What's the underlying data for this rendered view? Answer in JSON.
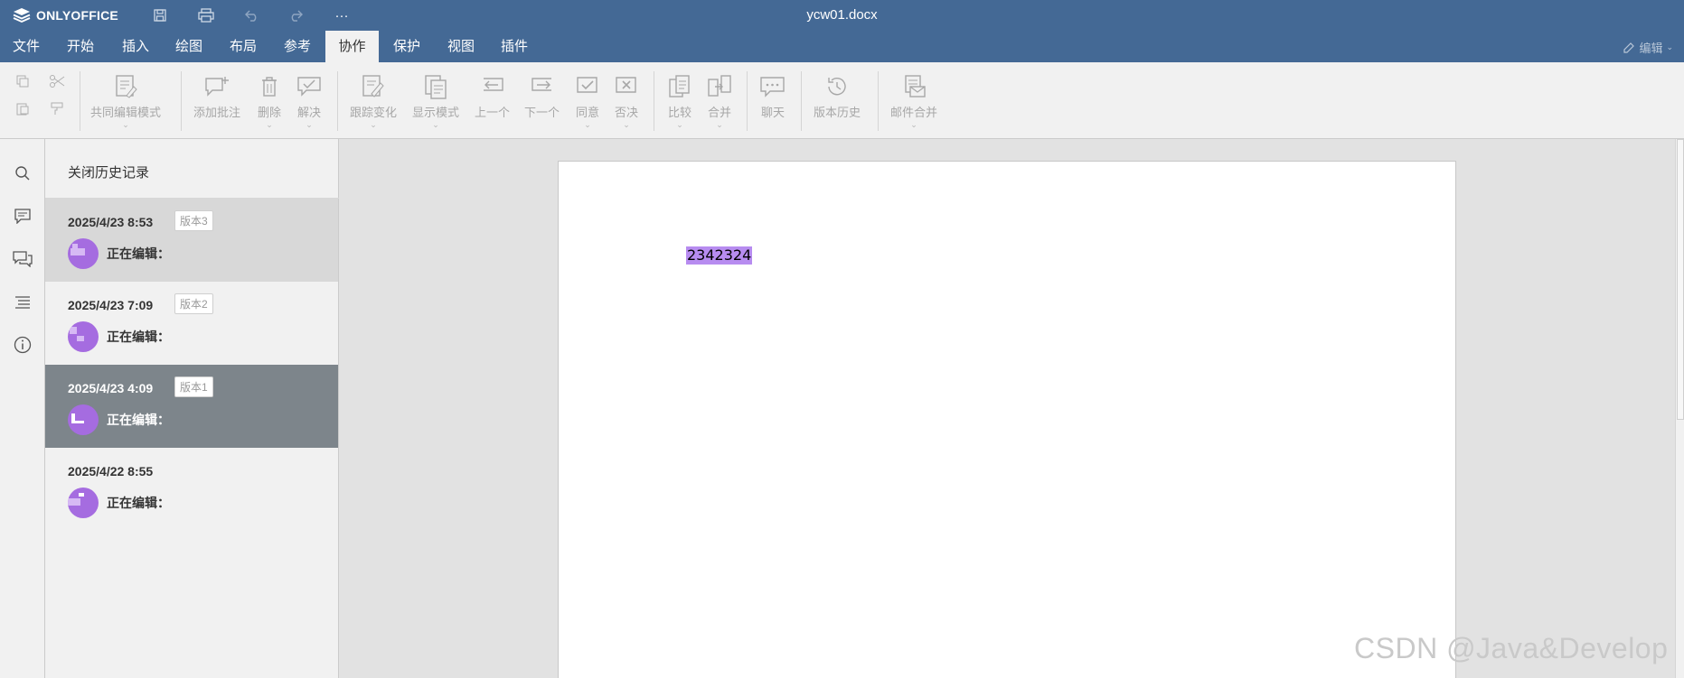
{
  "titlebar": {
    "app_name": "ONLYOFFICE",
    "document_title": "ycw01.docx",
    "more": "···"
  },
  "menu": {
    "tabs": [
      "文件",
      "开始",
      "插入",
      "绘图",
      "布局",
      "参考",
      "协作",
      "保护",
      "视图",
      "插件"
    ],
    "active_tab": "协作",
    "edit_mode_label": "编辑"
  },
  "toolbar": {
    "coedit_mode": "共同编辑模式",
    "add_comment": "添加批注",
    "delete": "删除",
    "resolve": "解决",
    "track_changes": "跟踪变化",
    "display_mode": "显示模式",
    "previous": "上一个",
    "next": "下一个",
    "accept": "同意",
    "reject": "否决",
    "compare": "比较",
    "merge": "合并",
    "chat": "聊天",
    "version_history": "版本历史",
    "mail_merge": "邮件合并"
  },
  "history": {
    "close_label": "关闭历史记录",
    "items": [
      {
        "date": "2025/4/23 8:53",
        "version": "版本3",
        "status": "正在编辑："
      },
      {
        "date": "2025/4/23 7:09",
        "version": "版本2",
        "status": "正在编辑："
      },
      {
        "date": "2025/4/23 4:09",
        "version": "版本1",
        "status": "正在编辑："
      },
      {
        "date": "2025/4/22 8:55",
        "version": "",
        "status": "正在编辑："
      }
    ]
  },
  "document": {
    "content": "2342324"
  },
  "watermark": "CSDN @Java&Develop",
  "colors": {
    "header": "#446995",
    "avatar": "#a56ce0",
    "highlight": "#b78cf0",
    "selected_item": "#7d858b"
  }
}
